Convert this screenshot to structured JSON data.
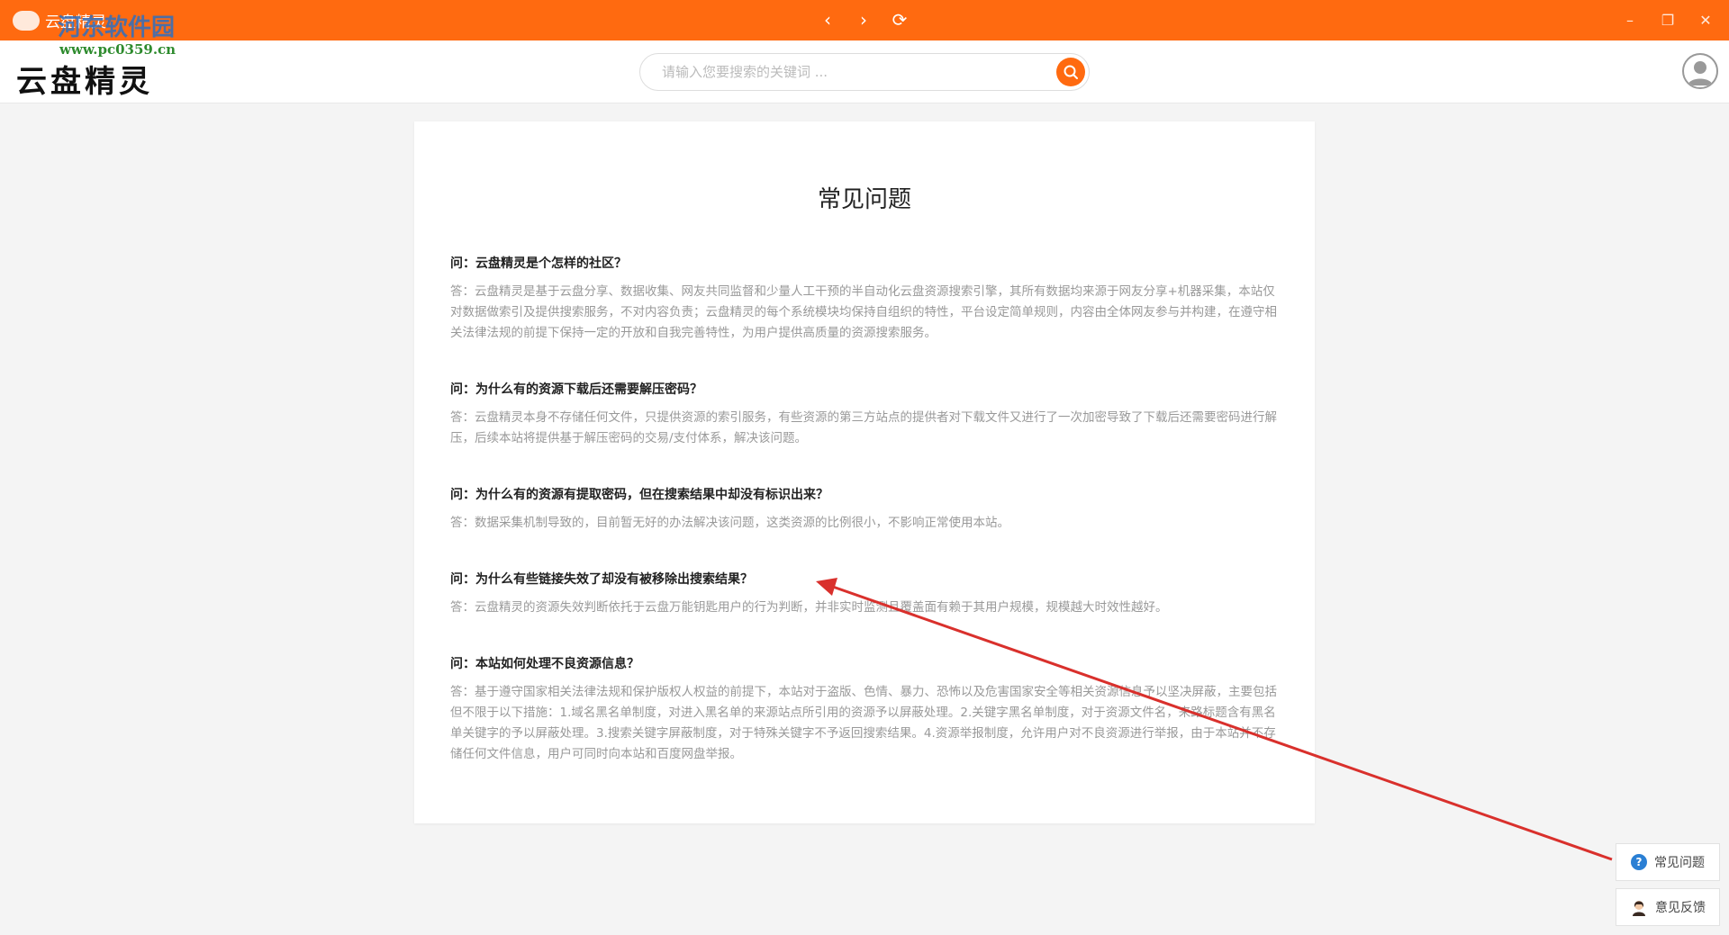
{
  "titlebar": {
    "app_title": "云盘精灵",
    "back_icon": "chevron-left-icon",
    "forward_icon": "chevron-right-icon",
    "refresh_icon": "refresh-icon",
    "minimize_icon": "minimize-icon",
    "restore_icon": "restore-icon",
    "close_icon": "close-icon",
    "back_glyph": "‹",
    "forward_glyph": "›",
    "refresh_glyph": "⟳",
    "minimize_glyph": "–",
    "restore_glyph": "❐",
    "close_glyph": "✕"
  },
  "watermark": {
    "site_name": "河东软件园",
    "site_url": "www.pc0359.cn"
  },
  "header": {
    "logo_text": "云盘精灵",
    "search_placeholder": "请输入您要搜索的关键词 ...",
    "search_value": "",
    "search_icon": "search-icon",
    "avatar_icon": "user-avatar-icon"
  },
  "page": {
    "title": "常见问题",
    "faqs": [
      {
        "q": "问：云盘精灵是个怎样的社区？",
        "a": "答：云盘精灵是基于云盘分享、数据收集、网友共同监督和少量人工干预的半自动化云盘资源搜索引擎，其所有数据均来源于网友分享+机器采集，本站仅对数据做索引及提供搜索服务，不对内容负责；云盘精灵的每个系统模块均保持自组织的特性，平台设定简单规则，内容由全体网友参与并构建，在遵守相关法律法规的前提下保持一定的开放和自我完善特性，为用户提供高质量的资源搜索服务。"
      },
      {
        "q": "问：为什么有的资源下载后还需要解压密码？",
        "a": "答：云盘精灵本身不存储任何文件，只提供资源的索引服务，有些资源的第三方站点的提供者对下载文件又进行了一次加密导致了下载后还需要密码进行解压，后续本站将提供基于解压密码的交易/支付体系，解决该问题。"
      },
      {
        "q": "问：为什么有的资源有提取密码，但在搜索结果中却没有标识出来？",
        "a": "答：数据采集机制导致的，目前暂无好的办法解决该问题，这类资源的比例很小，不影响正常使用本站。"
      },
      {
        "q": "问：为什么有些链接失效了却没有被移除出搜索结果？",
        "a": "答：云盘精灵的资源失效判断依托于云盘万能钥匙用户的行为判断，并非实时监测且覆盖面有赖于其用户规模，规模越大时效性越好。"
      },
      {
        "q": "问：本站如何处理不良资源信息？",
        "a": "答：基于遵守国家相关法律法规和保护版权人权益的前提下，本站对于盗版、色情、暴力、恐怖以及危害国家安全等相关资源信息予以坚决屏蔽，主要包括但不限于以下措施：1.域名黑名单制度，对进入黑名单的来源站点所引用的资源予以屏蔽处理。2.关键字黑名单制度，对于资源文件名，来路标题含有黑名单关键字的予以屏蔽处理。3.搜索关键字屏蔽制度，对于特殊关键字不予返回搜索结果。4.资源举报制度，允许用户对不良资源进行举报，由于本站并不存储任何文件信息，用户可同时向本站和百度网盘举报。"
      }
    ]
  },
  "side": {
    "faq_label": "常见问题",
    "feedback_label": "意见反馈",
    "faq_icon": "question-icon",
    "feedback_icon": "customer-service-icon"
  },
  "colors": {
    "accent": "#ff6a10",
    "annotation_arrow": "#d9302c"
  }
}
